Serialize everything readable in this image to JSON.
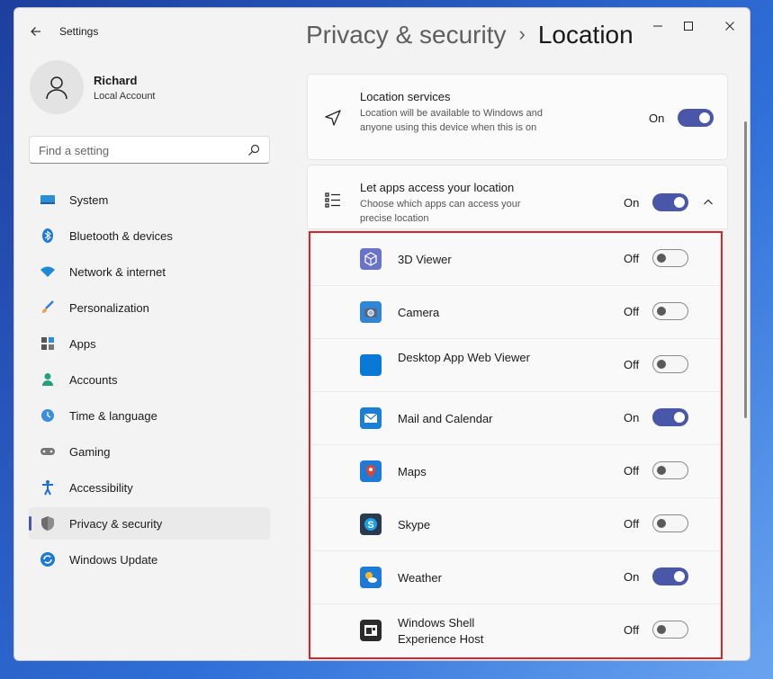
{
  "window": {
    "app_title": "Settings"
  },
  "header": {
    "parent": "Privacy & security",
    "separator": "›",
    "current": "Location"
  },
  "user": {
    "name": "Richard",
    "account_type": "Local Account"
  },
  "search": {
    "placeholder": "Find a setting"
  },
  "sidebar": {
    "items": [
      {
        "label": "System",
        "icon": "monitor-icon"
      },
      {
        "label": "Bluetooth & devices",
        "icon": "bluetooth-icon"
      },
      {
        "label": "Network & internet",
        "icon": "wifi-icon"
      },
      {
        "label": "Personalization",
        "icon": "brush-icon"
      },
      {
        "label": "Apps",
        "icon": "apps-grid-icon"
      },
      {
        "label": "Accounts",
        "icon": "person-icon"
      },
      {
        "label": "Time & language",
        "icon": "clock-globe-icon"
      },
      {
        "label": "Gaming",
        "icon": "gamepad-icon"
      },
      {
        "label": "Accessibility",
        "icon": "accessibility-icon"
      },
      {
        "label": "Privacy & security",
        "icon": "shield-icon",
        "active": true
      },
      {
        "label": "Windows Update",
        "icon": "update-icon"
      }
    ]
  },
  "location_services": {
    "title": "Location services",
    "description": "Location will be available to Windows and anyone using this device when this is on",
    "state": "On",
    "enabled": true
  },
  "app_access": {
    "title": "Let apps access your location",
    "description": "Choose which apps can access your precise location",
    "state": "On",
    "enabled": true,
    "expanded": true
  },
  "apps": [
    {
      "name": "3D Viewer",
      "state": "Off",
      "enabled": false,
      "icon": "cube-icon"
    },
    {
      "name": "Camera",
      "state": "Off",
      "enabled": false,
      "icon": "camera-icon"
    },
    {
      "name": "Desktop App Web Viewer",
      "state": "Off",
      "enabled": false,
      "icon": "web-viewer-icon"
    },
    {
      "name": "Mail and Calendar",
      "state": "On",
      "enabled": true,
      "icon": "mail-icon"
    },
    {
      "name": "Maps",
      "state": "Off",
      "enabled": false,
      "icon": "map-pin-icon"
    },
    {
      "name": "Skype",
      "state": "Off",
      "enabled": false,
      "icon": "skype-icon"
    },
    {
      "name": "Weather",
      "state": "On",
      "enabled": true,
      "icon": "weather-icon"
    },
    {
      "name": "Windows Shell Experience Host",
      "state": "Off",
      "enabled": false,
      "icon": "shell-host-icon"
    }
  ],
  "colors": {
    "accent": "#4a56a8",
    "highlight_border": "#d8242c",
    "window_bg": "#f3f3f3"
  }
}
